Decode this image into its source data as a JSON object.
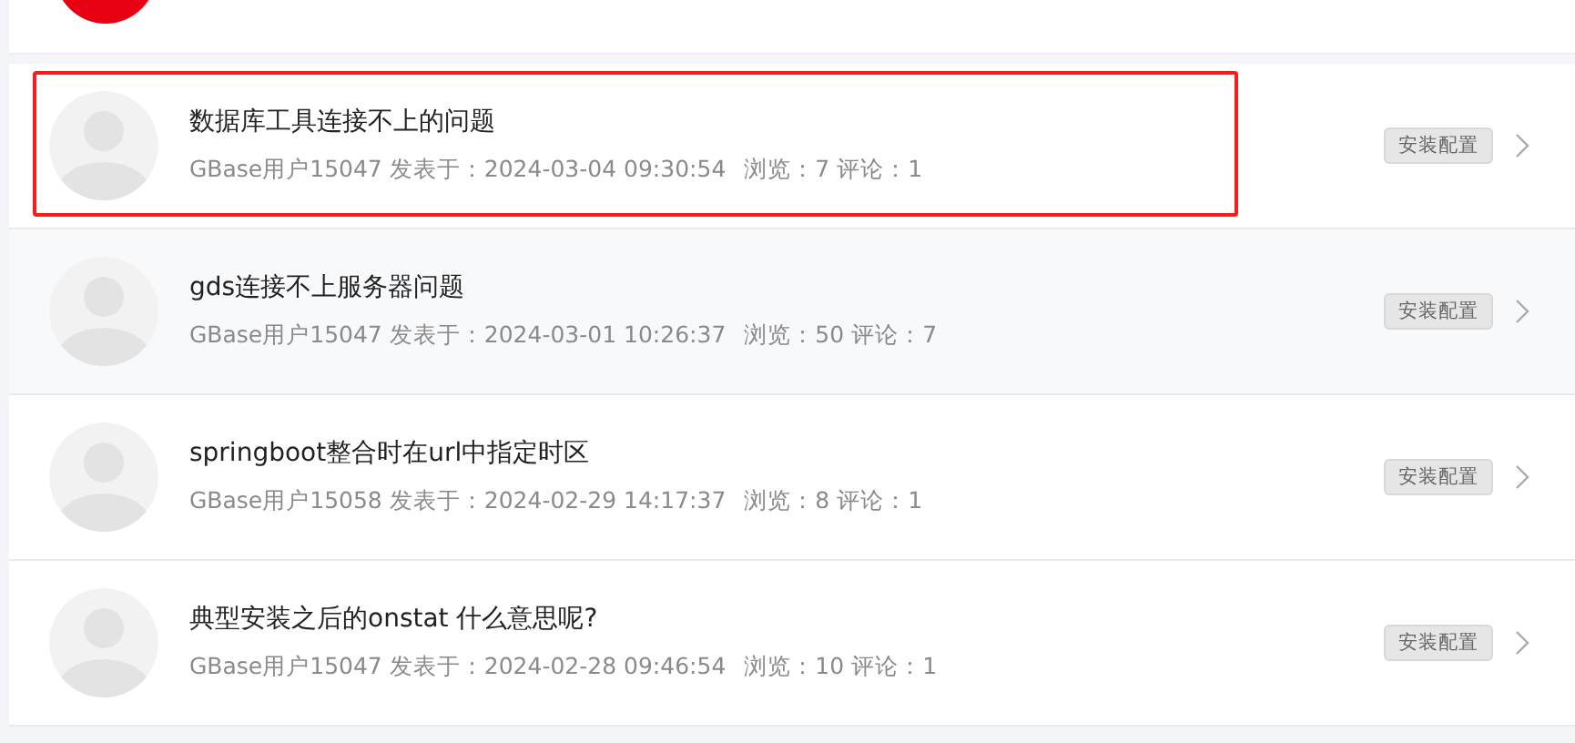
{
  "posts": [
    {
      "title": "数据库工具连接不上的问题",
      "author": "GBase用户15047",
      "posted": "发表于：2024-03-04 09:30:54",
      "views": "浏览：7",
      "comments": "评论：1",
      "tag": "安装配置",
      "highlighted": true,
      "hovered": false
    },
    {
      "title": "gds连接不上服务器问题",
      "author": "GBase用户15047",
      "posted": "发表于：2024-03-01 10:26:37",
      "views": "浏览：50",
      "comments": "评论：7",
      "tag": "安装配置",
      "highlighted": false,
      "hovered": true
    },
    {
      "title": "springboot整合时在url中指定时区",
      "author": "GBase用户15058",
      "posted": "发表于：2024-02-29 14:17:37",
      "views": "浏览：8",
      "comments": "评论：1",
      "tag": "安装配置",
      "highlighted": false,
      "hovered": false
    },
    {
      "title": "典型安装之后的onstat 什么意思呢?",
      "author": "GBase用户15047",
      "posted": "发表于：2024-02-28 09:46:54",
      "views": "浏览：10",
      "comments": "评论：1",
      "tag": "安装配置",
      "highlighted": false,
      "hovered": false
    }
  ]
}
